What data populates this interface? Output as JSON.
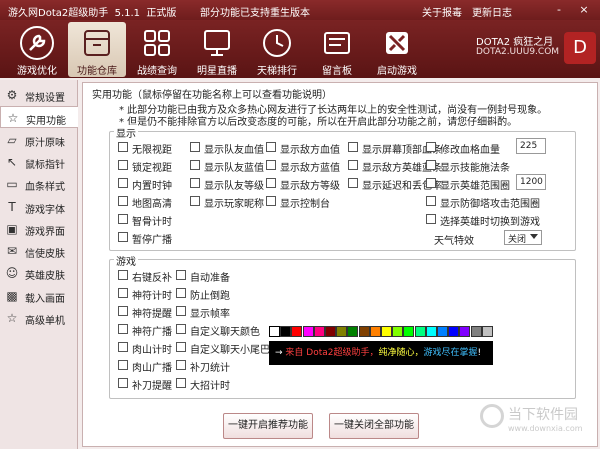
{
  "window": {
    "title": "游久网Dota2超级助手",
    "version": "5.1.1",
    "edition": "正式版",
    "notice": "部分功能已支持重生版本"
  },
  "title_links": {
    "report": "关于报毒",
    "changelog": "更新日志"
  },
  "window_controls": [
    "-",
    "×"
  ],
  "toolbar": [
    {
      "label": "游戏优化",
      "icon": "wrench-icon"
    },
    {
      "label": "功能仓库",
      "icon": "warehouse-icon"
    },
    {
      "label": "战绩查询",
      "icon": "grid-icon"
    },
    {
      "label": "明星直播",
      "icon": "monitor-icon"
    },
    {
      "label": "天梯排行",
      "icon": "clock-icon"
    },
    {
      "label": "留言板",
      "icon": "message-board-icon"
    },
    {
      "label": "启动游戏",
      "icon": "dota-logo-icon"
    }
  ],
  "brand": {
    "line1": "DOTA2 疯狂之月",
    "line2": "DOTA2.UUU9.COM",
    "logo": "D"
  },
  "sidebar": [
    {
      "label": "常规设置",
      "icon": "gear-icon"
    },
    {
      "label": "实用功能",
      "icon": "star-icon"
    },
    {
      "label": "原汁原味",
      "icon": "cup-icon"
    },
    {
      "label": "鼠标指针",
      "icon": "cursor-icon"
    },
    {
      "label": "血条样式",
      "icon": "health-bar-icon"
    },
    {
      "label": "游戏字体",
      "icon": "font-icon"
    },
    {
      "label": "游戏界面",
      "icon": "window-icon"
    },
    {
      "label": "信使皮肤",
      "icon": "courier-icon"
    },
    {
      "label": "英雄皮肤",
      "icon": "hero-icon"
    },
    {
      "label": "载入画面",
      "icon": "image-icon"
    },
    {
      "label": "高级单机",
      "icon": "star-outline-icon"
    }
  ],
  "content": {
    "header": "实用功能（鼠标停留在功能名称上可以查看功能说明）",
    "notes": [
      "* 此部分功能已由我方及众多热心网友进行了长达两年以上的安全性测试，尚没有一例封号现象。",
      "* 但是仍不能排除官方以后改变态度的可能，所以在开启此部分功能之前，请您仔细斟酌。"
    ]
  },
  "display_group": {
    "title": "显示",
    "col1": [
      "无限视距",
      "锁定视距",
      "内置时钟",
      "地图高清",
      "智骨计时",
      "暂停广播"
    ],
    "col2": [
      "显示队友血值",
      "显示队友蓝值",
      "显示队友等级",
      "显示玩家昵称"
    ],
    "col3": [
      "显示敌方血值",
      "显示敌方蓝值",
      "显示敌方等级",
      "显示控制台"
    ],
    "col4": [
      "显示屏幕顶部血条",
      "显示敌方英雄蓝条",
      "显示延迟和丢包率"
    ],
    "col5": [
      "修改血格血量",
      "显示技能施法条",
      "显示英雄范围圈",
      "显示防御塔攻击范围圈",
      "选择英雄时切换到游戏"
    ],
    "hp_value": "225",
    "range_value": "1200",
    "weather_label": "天气特效",
    "weather_value": "关闭"
  },
  "game_group": {
    "title": "游戏",
    "col1": [
      "右键反补",
      "神符计时",
      "神符提醒",
      "神符广播",
      "肉山计时",
      "肉山广播",
      "补刀提醒"
    ],
    "col2": [
      "自动准备",
      "防止倒跑",
      "显示帧率",
      "自定义聊天颜色",
      "自定义聊天小尾巴",
      "补刀统计",
      "大招计时"
    ]
  },
  "colors": [
    "#ffffff",
    "#000000",
    "#ff0000",
    "#ff00ff",
    "#ff0080",
    "#800000",
    "#808000",
    "#008000",
    "#804000",
    "#ff8000",
    "#ffff00",
    "#80ff00",
    "#00ff00",
    "#00ff80",
    "#00ffff",
    "#0080ff",
    "#0000ff",
    "#8000ff",
    "#808080",
    "#c0c0c0"
  ],
  "marquee": {
    "arrow": "→",
    "part1": "来自 Dota2超级助手，",
    "part2": "纯净随心，",
    "part3": "游戏尽在掌握",
    "end": "!"
  },
  "buttons": {
    "enable_recommended": "一键开启推荐功能",
    "disable_all": "一键关闭全部功能"
  },
  "watermark": {
    "line1": "当下软件园",
    "line2": "www.downxia.com"
  }
}
